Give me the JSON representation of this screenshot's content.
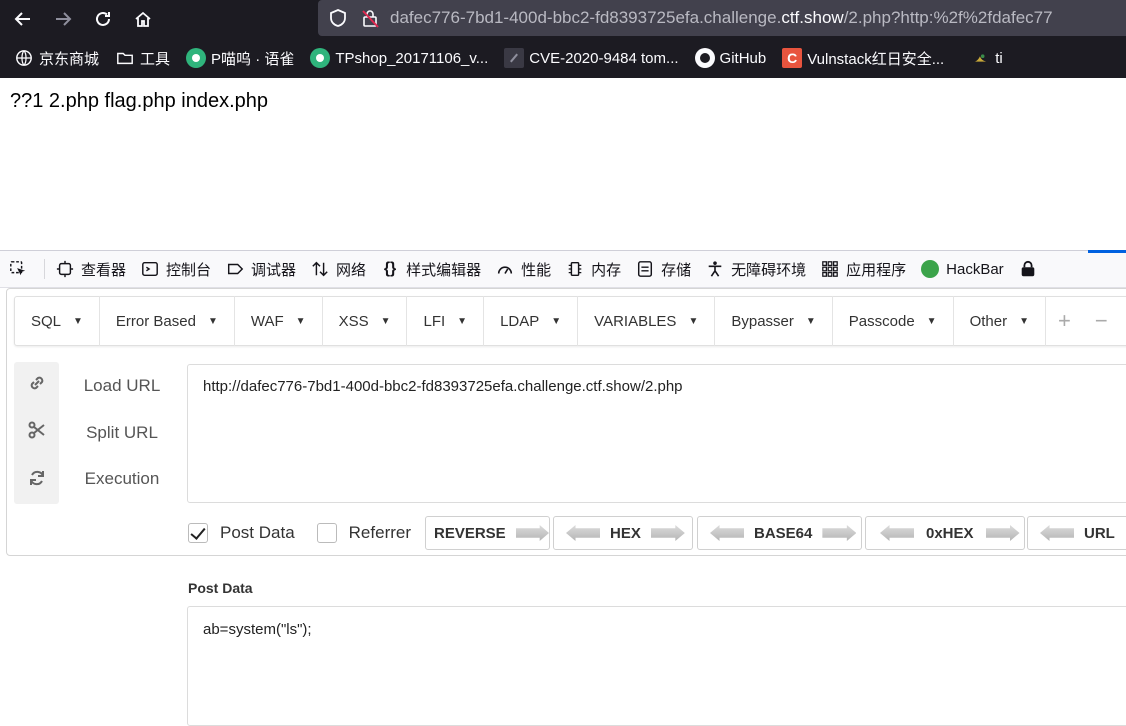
{
  "browser": {
    "url_host_dim": "dafec776-7bd1-400d-bbc2-fd8393725efa.challenge.",
    "url_host_bright": "ctf.show",
    "url_path": "/2.php?http:%2f%2fdafec77"
  },
  "bookmarks": [
    {
      "label": "京东商城",
      "icon": "globe-icon"
    },
    {
      "label": "工具",
      "icon": "folder-icon"
    },
    {
      "label": "P喵呜 · 语雀",
      "icon": "yuque-icon"
    },
    {
      "label": "TPshop_20171106_v...",
      "icon": "yuque-icon"
    },
    {
      "label": "CVE-2020-9484 tom...",
      "icon": "page-icon"
    },
    {
      "label": "GitHub",
      "icon": "github-icon"
    },
    {
      "label": "Vulnstack红日安全...",
      "icon": "c-icon"
    },
    {
      "label": "ti",
      "icon": "bird-icon"
    }
  ],
  "page": {
    "output": "??1 2.php flag.php index.php"
  },
  "devtools": {
    "tabs": [
      "查看器",
      "控制台",
      "调试器",
      "网络",
      "样式编辑器",
      "性能",
      "内存",
      "存储",
      "无障碍环境",
      "应用程序",
      "HackBar"
    ]
  },
  "hackbar": {
    "menu": [
      "SQL",
      "Error Based",
      "WAF",
      "XSS",
      "LFI",
      "LDAP",
      "VARIABLES",
      "Bypasser",
      "Passcode",
      "Other"
    ],
    "plus": "+",
    "minus": "−",
    "actions": [
      "Load URL",
      "Split URL",
      "Execution"
    ],
    "url_value": "http://dafec776-7bd1-400d-bbc2-fd8393725efa.challenge.ctf.show/2.php",
    "post_data_checkbox": {
      "label": "Post Data",
      "checked": true
    },
    "referrer_checkbox": {
      "label": "Referrer",
      "checked": false
    },
    "encoders": [
      "REVERSE",
      "HEX",
      "BASE64",
      "0xHEX",
      "URL"
    ],
    "post_data_title": "Post Data",
    "post_data_value": "ab=system(\"ls\");"
  }
}
